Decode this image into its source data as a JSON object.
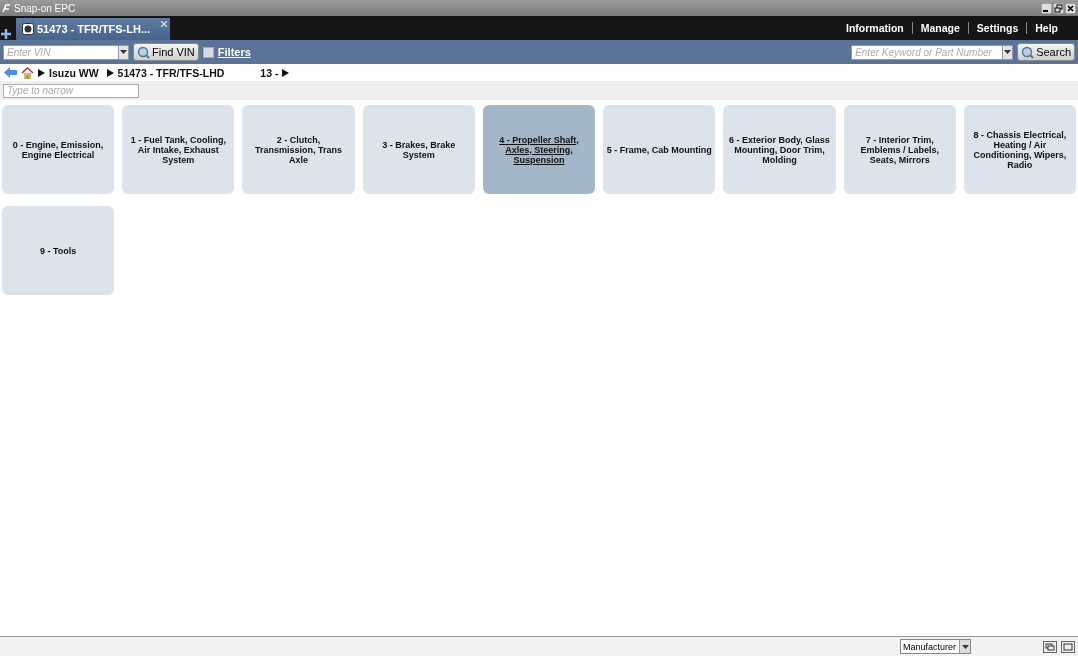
{
  "window": {
    "title": "Snap-on EPC"
  },
  "tabs": [
    {
      "label": "51473 - TFR/TFS-LH...",
      "selected": true
    }
  ],
  "top_menu": [
    "Information",
    "Manage",
    "Settings",
    "Help"
  ],
  "toolbar": {
    "vin_field": {
      "placeholder": "Enter VIN"
    },
    "find_vin_button": "Find VIN",
    "filters": {
      "label": "Filters",
      "checked": false
    },
    "search_field": {
      "placeholder": "Enter Keyword or Part Number"
    },
    "search_button": "Search"
  },
  "breadcrumb": [
    "Isuzu WW",
    "51473 - TFR/TFS-LHD",
    "13 -"
  ],
  "narrow_field": {
    "placeholder": "Type to narrow"
  },
  "categories": [
    {
      "label": "0 - Engine, Emission, Engine Electrical",
      "selected": false
    },
    {
      "label": "1 - Fuel Tank, Cooling, Air Intake, Exhaust System",
      "selected": false
    },
    {
      "label": "2 - Clutch, Transmission, Trans Axle",
      "selected": false
    },
    {
      "label": "3 - Brakes, Brake System",
      "selected": false
    },
    {
      "label": "4 - Propeller Shaft, Axles, Steering, Suspension",
      "selected": true
    },
    {
      "label": "5 - Frame, Cab Mounting",
      "selected": false
    },
    {
      "label": "6 - Exterior Body, Glass Mounting, Door Trim, Molding",
      "selected": false
    },
    {
      "label": "7 - Interior Trim, Emblems / Labels, Seats, Mirrors",
      "selected": false
    },
    {
      "label": "8 - Chassis Electrical, Heating / Air Conditioning, Wipers, Radio",
      "selected": false
    },
    {
      "label": "9 - Tools",
      "selected": false
    }
  ],
  "status_bar": {
    "dropdown": "Manufacturer"
  }
}
